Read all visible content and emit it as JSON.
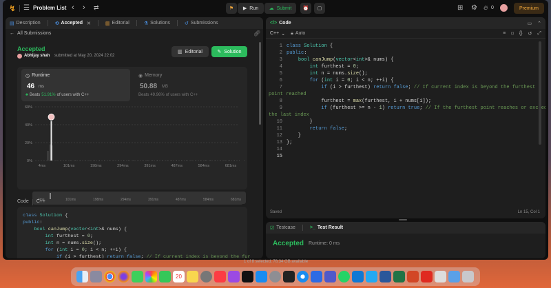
{
  "topbar": {
    "logo_icon": "leetcode-logo",
    "title": "Problem List",
    "run_label": "Run",
    "submit_label": "Submit",
    "streak_count": "0",
    "premium_label": "Premium"
  },
  "left_tabs": [
    {
      "label": "Description",
      "icon": "doc-icon"
    },
    {
      "label": "Accepted",
      "icon": "check-icon"
    },
    {
      "label": "Editorial",
      "icon": "book-icon"
    },
    {
      "label": "Solutions",
      "icon": "flask-icon"
    },
    {
      "label": "Submissions",
      "icon": "history-icon"
    }
  ],
  "submission": {
    "back_label": "All Submissions",
    "status": "Accepted",
    "author": "Abhijay shah",
    "submitted_text": "submitted at May 20, 2024 22:02",
    "editorial_btn": "Editorial",
    "solution_btn": "Solution",
    "runtime": {
      "label": "Runtime",
      "value": "46",
      "unit": "ms",
      "beats_prefix": "Beats",
      "beats_pct": "51.91%",
      "beats_suffix": "of users with C++"
    },
    "memory": {
      "label": "Memory",
      "value": "50.88",
      "unit": "MB",
      "beats_prefix": "Beats",
      "beats_pct": "49.96%",
      "beats_suffix": "of users with C++"
    }
  },
  "chart_data": {
    "type": "bar",
    "y_ticks": [
      "60%",
      "40%",
      "20%",
      "0%"
    ],
    "x_ticks": [
      "4ms",
      "101ms",
      "198ms",
      "294ms",
      "391ms",
      "487ms",
      "584ms",
      "681ms"
    ],
    "ylim": [
      0,
      60
    ],
    "grid": true,
    "highlight": "46ms",
    "highlight_value": 44
  },
  "minimap_ticks": [
    "4ms",
    "101ms",
    "198ms",
    "294ms",
    "391ms",
    "487ms",
    "584ms",
    "681ms"
  ],
  "code_preview": {
    "label": "Code",
    "lang": "C++",
    "lines": [
      "class Solution {",
      "public:",
      "    bool canJump(vector<int>& nums) {",
      "        int furthest = 0;",
      "        int n = nums.size();",
      "        for (int i = 0; i < n; ++i) {",
      "            if (i > furthest) return false; // If current index is beyond the fur"
    ]
  },
  "editor": {
    "title": "Code",
    "lang": "C++",
    "mode": "Auto",
    "status_left": "Saved",
    "status_right": "Ln 15, Col 1",
    "lines": [
      "class Solution {",
      "public:",
      "    bool canJump(vector<int>& nums) {",
      "        int furthest = 0;",
      "        int n = nums.size();",
      "        for (int i = 0; i < n; ++i) {",
      "            if (i > furthest) return false; // If current index is beyond the furthest",
      "point reached",
      "            furthest = max(furthest, i + nums[i]);",
      "            if (furthest >= n - 1) return true; // If the furthest point reaches or exceeds",
      "the last index",
      "        }",
      "        return false;",
      "    }",
      "};",
      ""
    ],
    "line_numbers": [
      "1",
      "2",
      "3",
      "4",
      "5",
      "6",
      "7",
      "",
      "8",
      "9",
      "",
      "10",
      "11",
      "12",
      "13",
      "14",
      "15"
    ]
  },
  "testpane": {
    "tab1": "Testcase",
    "tab2": "Test Result",
    "status": "Accepted",
    "runtime_text": "Runtime: 0 ms"
  },
  "finder_status": "1 of 8 selected, 78.34 GB available"
}
